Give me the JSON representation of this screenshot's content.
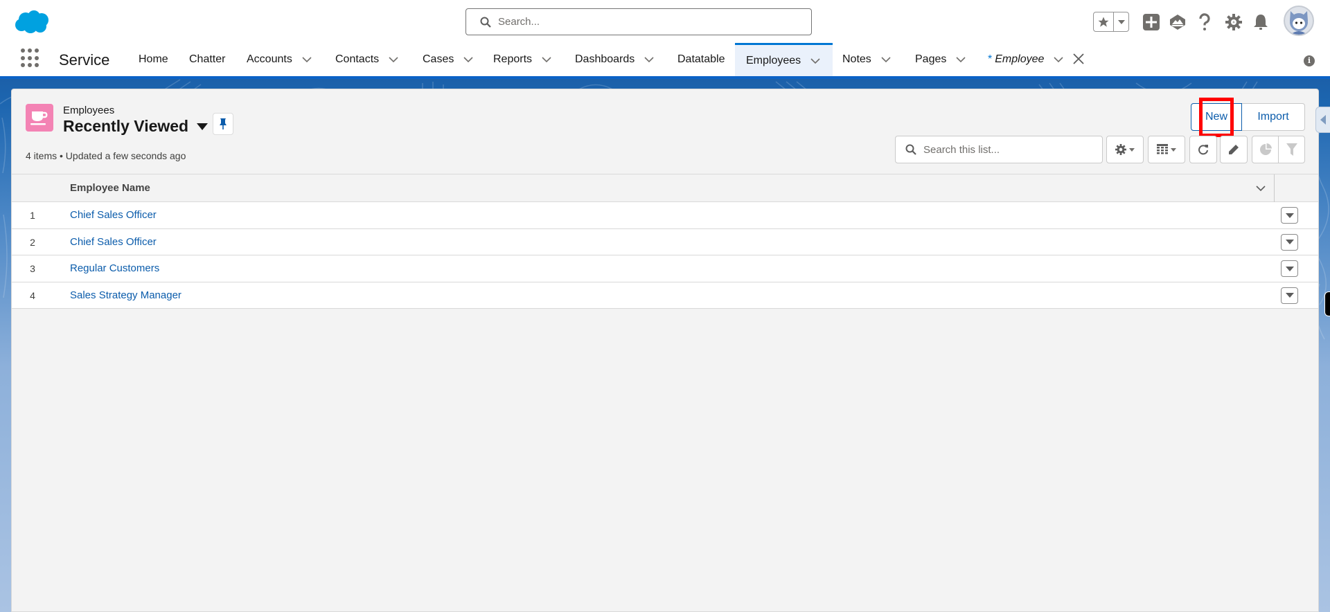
{
  "global_header": {
    "search_placeholder": "Search...",
    "icons": [
      "salesforce-cloud-logo",
      "favorites-star-icon",
      "chevron-down-icon",
      "global-actions-plus-icon",
      "trailhead-icon",
      "help-icon",
      "setup-gear-icon",
      "notifications-bell-icon",
      "user-avatar"
    ]
  },
  "navbar": {
    "app_name": "Service",
    "items": [
      {
        "label": "Home",
        "has_menu": false
      },
      {
        "label": "Chatter",
        "has_menu": false
      },
      {
        "label": "Accounts",
        "has_menu": true
      },
      {
        "label": "Contacts",
        "has_menu": true
      },
      {
        "label": "Cases",
        "has_menu": true
      },
      {
        "label": "Reports",
        "has_menu": true
      },
      {
        "label": "Dashboards",
        "has_menu": true
      },
      {
        "label": "Datatable",
        "has_menu": false
      },
      {
        "label": "Employees",
        "has_menu": true,
        "active": true
      },
      {
        "label": "Notes",
        "has_menu": true
      },
      {
        "label": "Pages",
        "has_menu": true
      },
      {
        "label": "Employee",
        "has_menu": true,
        "unsaved_marker": "*",
        "italic": true,
        "closable": true
      }
    ]
  },
  "list_view": {
    "object_label": "Employees",
    "list_name": "Recently Viewed",
    "meta": "4 items • Updated a few seconds ago",
    "buttons": {
      "new": "New",
      "import": "Import"
    },
    "search_placeholder": "Search this list...",
    "columns": [
      {
        "label": "Employee Name"
      }
    ],
    "rows": [
      {
        "num": "1",
        "name": "Chief Sales Officer"
      },
      {
        "num": "2",
        "name": "Chief Sales Officer"
      },
      {
        "num": "3",
        "name": "Regular Customers"
      },
      {
        "num": "4",
        "name": "Sales Strategy Manager"
      }
    ]
  },
  "colors": {
    "brand_blue": "#0176d3",
    "link_blue": "#0b5cab",
    "object_icon_pink": "#f383b4",
    "highlight_red": "#ff0000"
  }
}
